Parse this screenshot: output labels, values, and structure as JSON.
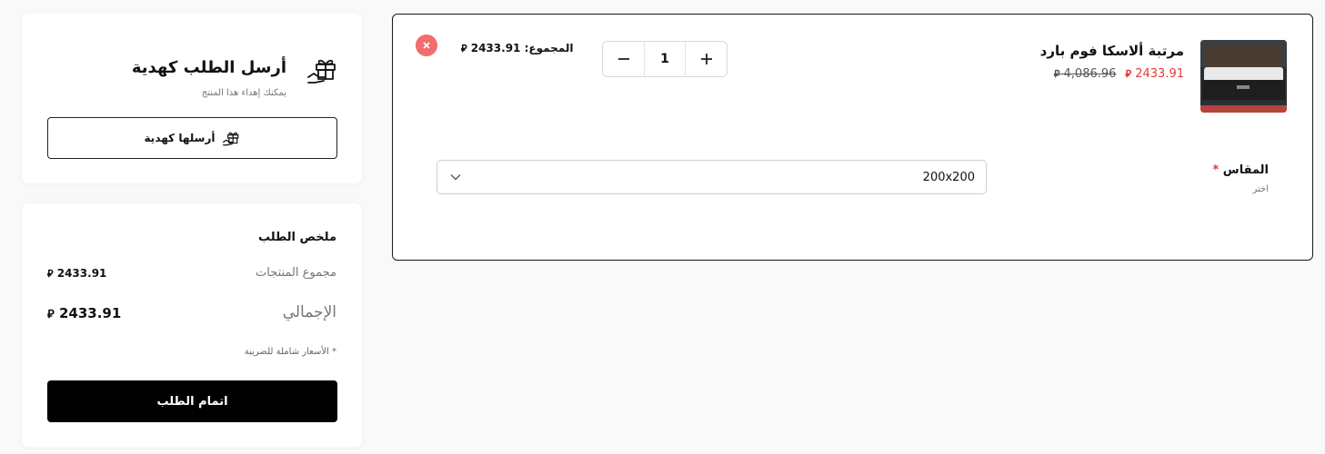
{
  "cart_item": {
    "product_name": "مرتبة ألاسكا فوم بارد",
    "sale_price": "2433.91",
    "original_price": "4,086.96",
    "currency_symbol": "⃁",
    "quantity": "1",
    "total_label": "المجموع:",
    "total_value": "2433.91",
    "option_label": "المقاس",
    "option_required_mark": "*",
    "option_hint": "اختر",
    "option_selected": "200x200"
  },
  "gift": {
    "title": "أرسل الطلب كهدية",
    "subtitle": "يمكنك إهداء هذا المنتج",
    "button_label": "أرسلها كهدية"
  },
  "summary": {
    "title": "ملخص الطلب",
    "subtotal_label": "مجموع المنتجات",
    "subtotal_value": "2433.91",
    "total_label": "الإجمالي",
    "total_value": "2433.91",
    "tax_note": "* الأسعار شاملة للضريبة",
    "checkout_label": "اتمام الطلب"
  },
  "colors": {
    "sale_price": "#e53935",
    "remove_button": "#f26d6d",
    "checkout_button": "#000000"
  }
}
